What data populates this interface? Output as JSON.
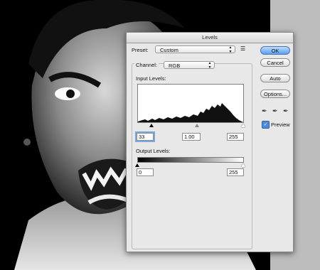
{
  "dialog": {
    "title": "Levels",
    "preset_label": "Preset:",
    "preset_value": "Custom",
    "preset_menu_icon": "list-options-icon",
    "channel_label": "Channel:",
    "channel_value": "RGB",
    "input_levels_label": "Input Levels:",
    "input_black": "33",
    "input_gamma": "1.00",
    "input_white": "255",
    "output_levels_label": "Output Levels:",
    "output_black": "0",
    "output_white": "255",
    "buttons": {
      "ok": "OK",
      "cancel": "Cancel",
      "auto": "Auto",
      "options": "Options..."
    },
    "preview_label": "Preview",
    "preview_checked": true,
    "checkmark": "✓"
  },
  "photo": {
    "description_icon": "photo-icon"
  }
}
